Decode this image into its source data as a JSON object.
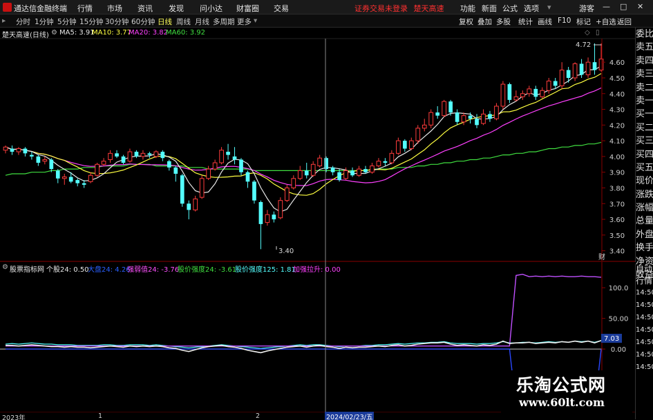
{
  "app": {
    "title": "通达信金融终端"
  },
  "menu": [
    "行情",
    "市场",
    "资讯",
    "发现",
    "问小达",
    "财富圈",
    "交易"
  ],
  "warning": "证券交易未登录",
  "stock_name_top": "楚天高速",
  "right_menu": [
    "功能",
    "新面",
    "公式",
    "选项"
  ],
  "user": "游客",
  "periods": [
    "分时",
    "1分钟",
    "5分钟",
    "15分钟",
    "30分钟",
    "60分钟",
    "日线",
    "周线",
    "月线",
    "多周期",
    "更多"
  ],
  "active_period": "日线",
  "right_tools": [
    "复权",
    "叠加",
    "多股",
    "统计",
    "画线",
    "F10",
    "标记",
    "+自选",
    "返回"
  ],
  "info": {
    "stock": "楚天高速(日线)",
    "ma5": "MA5: 3.91",
    "ma10": "MA10: 3.77",
    "ma20": "MA20: 3.82",
    "ma60": "MA60: 3.92"
  },
  "price_axis": [
    "4.60",
    "4.50",
    "4.40",
    "4.30",
    "4.20",
    "4.10",
    "4.00",
    "3.90",
    "3.80",
    "3.70",
    "3.60",
    "3.50",
    "3.40"
  ],
  "price_high_label": "4.72",
  "price_low_label": "3.40",
  "axis_corner": "财",
  "side_panel": [
    "委比",
    "卖五",
    "卖四",
    "卖三",
    "卖二",
    "卖一",
    "买一",
    "买二",
    "买三",
    "买四",
    "买五",
    "现价",
    "涨跌",
    "涨幅",
    "总量",
    "外盘",
    "换手",
    "净资",
    "收益"
  ],
  "indicator": {
    "name": "股票指标网",
    "l1": "个股24: 0.50",
    "l2": "大盘24: 4.26",
    "l3": "强弱值24: -3.76",
    "l4": "股价强度24: -3.61",
    "l5": "股价强度125: 1.81",
    "l6": "加强拉升: 0.00"
  },
  "ind_axis": [
    "100.0",
    "50.00",
    "0.00"
  ],
  "ind_value_tag": "7.03",
  "side_panel2": [
    "自动",
    "行情",
    "14:50",
    "14:50",
    "14:50",
    "14:50",
    "14:50",
    "14:50",
    "14:50"
  ],
  "bottom": {
    "y2023": "2023年",
    "m1": "1",
    "m2": "2",
    "cursor": "2024/02/23/五"
  },
  "watermark": {
    "line1": "乐淘公式网",
    "line2": "www.60lt.com"
  },
  "colors": {
    "up": "#ff3c3c",
    "down": "#54ffff",
    "ma5": "#e8e8e8",
    "ma10": "#ffff40",
    "ma20": "#ff40ff",
    "ma60": "#40e040"
  },
  "chart_data": {
    "type": "candlestick",
    "y_range": [
      3.35,
      4.75
    ],
    "candles": [
      [
        4.04,
        4.06,
        4.02,
        4.07
      ],
      [
        4.05,
        4.03,
        4.01,
        4.07
      ],
      [
        4.03,
        4.05,
        4.01,
        4.06
      ],
      [
        4.05,
        4.02,
        4.0,
        4.06
      ],
      [
        4.01,
        4.0,
        3.98,
        4.03
      ],
      [
        4.0,
        3.96,
        3.94,
        4.01
      ],
      [
        3.97,
        3.98,
        3.95,
        4.0
      ],
      [
        3.98,
        3.92,
        3.9,
        3.99
      ],
      [
        3.91,
        3.86,
        3.83,
        3.92
      ],
      [
        3.86,
        3.87,
        3.82,
        3.89
      ],
      [
        3.87,
        3.84,
        3.83,
        3.9
      ],
      [
        3.85,
        3.83,
        3.81,
        3.86
      ],
      [
        3.83,
        3.82,
        3.8,
        3.85
      ],
      [
        3.84,
        3.88,
        3.83,
        3.9
      ],
      [
        3.88,
        3.95,
        3.87,
        3.96
      ],
      [
        3.95,
        3.97,
        3.94,
        3.99
      ],
      [
        3.98,
        4.02,
        3.96,
        4.04
      ],
      [
        4.02,
        4.0,
        3.99,
        4.04
      ],
      [
        4.0,
        3.96,
        3.95,
        4.01
      ],
      [
        3.97,
        4.03,
        3.96,
        4.05
      ],
      [
        4.03,
        4.0,
        3.99,
        4.04
      ],
      [
        4.0,
        4.02,
        3.98,
        4.04
      ],
      [
        4.02,
        4.01,
        3.99,
        4.03
      ],
      [
        4.0,
        4.03,
        3.99,
        4.04
      ],
      [
        4.03,
        3.99,
        3.97,
        4.04
      ],
      [
        3.97,
        3.93,
        3.91,
        3.98
      ],
      [
        3.93,
        3.89,
        3.84,
        3.94
      ],
      [
        3.88,
        3.7,
        3.68,
        3.89
      ],
      [
        3.7,
        3.66,
        3.6,
        3.72
      ],
      [
        3.66,
        3.73,
        3.65,
        3.75
      ],
      [
        3.74,
        3.86,
        3.73,
        3.88
      ],
      [
        3.86,
        3.92,
        3.85,
        3.94
      ],
      [
        3.92,
        3.96,
        3.91,
        3.98
      ],
      [
        3.96,
        4.04,
        3.95,
        4.06
      ],
      [
        4.03,
        4.01,
        3.98,
        4.08
      ],
      [
        4.0,
        3.98,
        3.95,
        4.06
      ],
      [
        3.98,
        3.9,
        3.88,
        3.99
      ],
      [
        3.9,
        3.84,
        3.8,
        3.91
      ],
      [
        3.84,
        3.72,
        3.7,
        3.85
      ],
      [
        3.71,
        3.57,
        3.41,
        3.72
      ],
      [
        3.58,
        3.63,
        3.56,
        3.66
      ],
      [
        3.63,
        3.6,
        3.58,
        3.65
      ],
      [
        3.61,
        3.72,
        3.6,
        3.74
      ],
      [
        3.72,
        3.8,
        3.71,
        3.82
      ],
      [
        3.8,
        3.86,
        3.79,
        3.88
      ],
      [
        3.86,
        3.91,
        3.85,
        3.94
      ],
      [
        3.91,
        3.88,
        3.86,
        3.96
      ],
      [
        3.88,
        3.95,
        3.87,
        3.97
      ],
      [
        3.94,
        3.99,
        3.93,
        4.01
      ],
      [
        3.99,
        3.92,
        3.9,
        4.0
      ],
      [
        3.93,
        3.9,
        3.88,
        3.94
      ],
      [
        3.9,
        3.85,
        3.84,
        3.92
      ],
      [
        3.86,
        3.91,
        3.85,
        3.93
      ],
      [
        3.91,
        3.88,
        3.87,
        3.93
      ],
      [
        3.88,
        3.92,
        3.87,
        3.94
      ],
      [
        3.92,
        3.9,
        3.89,
        3.94
      ],
      [
        3.9,
        3.94,
        3.89,
        3.96
      ],
      [
        3.94,
        3.97,
        3.93,
        3.99
      ],
      [
        3.97,
        3.96,
        3.94,
        3.99
      ],
      [
        3.96,
        4.02,
        3.95,
        4.04
      ],
      [
        4.02,
        4.1,
        4.01,
        4.12
      ],
      [
        4.1,
        4.05,
        4.03,
        4.11
      ],
      [
        4.05,
        4.1,
        4.04,
        4.12
      ],
      [
        4.1,
        4.18,
        4.08,
        4.2
      ],
      [
        4.18,
        4.2,
        4.16,
        4.24
      ],
      [
        4.2,
        4.28,
        4.18,
        4.3
      ],
      [
        4.28,
        4.26,
        4.24,
        4.32
      ],
      [
        4.26,
        4.35,
        4.25,
        4.36
      ],
      [
        4.35,
        4.28,
        4.26,
        4.36
      ],
      [
        4.28,
        4.22,
        4.2,
        4.3
      ],
      [
        4.22,
        4.26,
        4.2,
        4.28
      ],
      [
        4.26,
        4.24,
        4.21,
        4.28
      ],
      [
        4.24,
        4.2,
        4.18,
        4.27
      ],
      [
        4.21,
        4.27,
        4.2,
        4.3
      ],
      [
        4.27,
        4.24,
        4.22,
        4.29
      ],
      [
        4.24,
        4.32,
        4.23,
        4.34
      ],
      [
        4.32,
        4.46,
        4.3,
        4.48
      ],
      [
        4.46,
        4.36,
        4.34,
        4.47
      ],
      [
        4.36,
        4.38,
        4.35,
        4.42
      ],
      [
        4.38,
        4.4,
        4.36,
        4.42
      ],
      [
        4.4,
        4.43,
        4.38,
        4.45
      ],
      [
        4.43,
        4.38,
        4.36,
        4.45
      ],
      [
        4.38,
        4.42,
        4.37,
        4.44
      ],
      [
        4.42,
        4.48,
        4.4,
        4.5
      ],
      [
        4.48,
        4.45,
        4.43,
        4.5
      ],
      [
        4.45,
        4.55,
        4.43,
        4.6
      ],
      [
        4.55,
        4.5,
        4.47,
        4.57
      ],
      [
        4.5,
        4.59,
        4.48,
        4.6
      ],
      [
        4.59,
        4.52,
        4.5,
        4.62
      ],
      [
        4.52,
        4.6,
        4.5,
        4.63
      ],
      [
        4.6,
        4.55,
        4.52,
        4.72
      ],
      [
        4.55,
        4.62,
        4.54,
        4.72
      ]
    ],
    "ma60": [
      3.88,
      3.89,
      3.89,
      3.89,
      3.9,
      3.9,
      3.9,
      3.91,
      3.91,
      3.92,
      3.92,
      3.92,
      3.93,
      3.93,
      3.93,
      3.94,
      3.94,
      3.94,
      3.94,
      3.95,
      3.95,
      3.95,
      3.95,
      3.94,
      3.94,
      3.94,
      3.94,
      3.94,
      3.93,
      3.93,
      3.93,
      3.92,
      3.92,
      3.92,
      3.92,
      3.92,
      3.92,
      3.92,
      3.91,
      3.91,
      3.91,
      3.91,
      3.91,
      3.91,
      3.91,
      3.91,
      3.91,
      3.91,
      3.91,
      3.91,
      3.91,
      3.91,
      3.91,
      3.91,
      3.91,
      3.91,
      3.92,
      3.92,
      3.92,
      3.92,
      3.93,
      3.93,
      3.93,
      3.94,
      3.94,
      3.95,
      3.95,
      3.96,
      3.96,
      3.97,
      3.97,
      3.98,
      3.98,
      3.99,
      3.99,
      4.0,
      4.01,
      4.01,
      4.02,
      4.02,
      4.03,
      4.03,
      4.04,
      4.05,
      4.05,
      4.06,
      4.06,
      4.07,
      4.07,
      4.08,
      4.08,
      4.09
    ],
    "indicator_series": {
      "purple": [
        5,
        5,
        5,
        5,
        5,
        5,
        5,
        5,
        5,
        5,
        5,
        5,
        5,
        5,
        5,
        5,
        5,
        5,
        5,
        5,
        5,
        5,
        5,
        5,
        5,
        5,
        5,
        5,
        5,
        5,
        5,
        5,
        5,
        5,
        5,
        5,
        5,
        5,
        5,
        5,
        5,
        5,
        5,
        5,
        5,
        5,
        5,
        5,
        5,
        5,
        5,
        5,
        5,
        5,
        5,
        5,
        5,
        5,
        5,
        5,
        5,
        5,
        5,
        5,
        5,
        5,
        5,
        5,
        5,
        5,
        5,
        5,
        5,
        5,
        5,
        5,
        5,
        5,
        120,
        122,
        118,
        119,
        118,
        119,
        118,
        119,
        118,
        118,
        119,
        118,
        118,
        117
      ],
      "blue": [
        0,
        0,
        0,
        0,
        0,
        0,
        0,
        0,
        0,
        0,
        0,
        0,
        0,
        0,
        0,
        0,
        0,
        0,
        0,
        0,
        0,
        0,
        0,
        0,
        0,
        0,
        0,
        0,
        0,
        0,
        0,
        0,
        0,
        0,
        0,
        0,
        0,
        0,
        0,
        0,
        0,
        0,
        0,
        0,
        0,
        0,
        0,
        0,
        0,
        0,
        0,
        0,
        0,
        0,
        0,
        0,
        0,
        0,
        0,
        0,
        0,
        0,
        0,
        0,
        0,
        0,
        0,
        0,
        0,
        0,
        0,
        0,
        0,
        0,
        0,
        0,
        0,
        0,
        -95,
        -95,
        -95,
        -95,
        -95,
        -95,
        -95,
        -95,
        -95,
        -95,
        -95,
        -95,
        -95,
        0
      ],
      "white": [
        6,
        6,
        5,
        6,
        7,
        6,
        5,
        4,
        4,
        3,
        4,
        3,
        3,
        2,
        3,
        4,
        5,
        4,
        3,
        5,
        4,
        5,
        4,
        5,
        4,
        2,
        1,
        -2,
        -4,
        -1,
        2,
        4,
        5,
        6,
        4,
        3,
        1,
        -2,
        -4,
        -6,
        -3,
        -1,
        1,
        3,
        4,
        5,
        3,
        5,
        6,
        4,
        3,
        1,
        3,
        2,
        3,
        3,
        4,
        5,
        4,
        6,
        7,
        5,
        6,
        8,
        9,
        10,
        10,
        11,
        8,
        6,
        7,
        6,
        5,
        7,
        6,
        8,
        13,
        9,
        10,
        10,
        11,
        9,
        10,
        11,
        10,
        12,
        11,
        13,
        11,
        13,
        10,
        14
      ],
      "cyan": [
        8,
        9,
        8,
        9,
        10,
        9,
        8,
        8,
        7,
        7,
        7,
        6,
        6,
        6,
        6,
        7,
        7,
        6,
        6,
        7,
        7,
        7,
        6,
        7,
        6,
        5,
        4,
        3,
        2,
        3,
        4,
        5,
        6,
        7,
        6,
        5,
        4,
        3,
        2,
        1,
        2,
        3,
        4,
        5,
        6,
        7,
        6,
        7,
        7,
        6,
        5,
        4,
        5,
        5,
        5,
        6,
        6,
        7,
        7,
        8,
        9,
        8,
        9,
        10,
        10,
        11,
        11,
        12,
        10,
        9,
        9,
        9,
        8,
        9,
        9,
        10,
        12,
        10,
        10,
        11,
        11,
        10,
        11,
        12,
        11,
        12,
        11,
        13,
        12,
        13,
        11,
        14
      ]
    }
  }
}
